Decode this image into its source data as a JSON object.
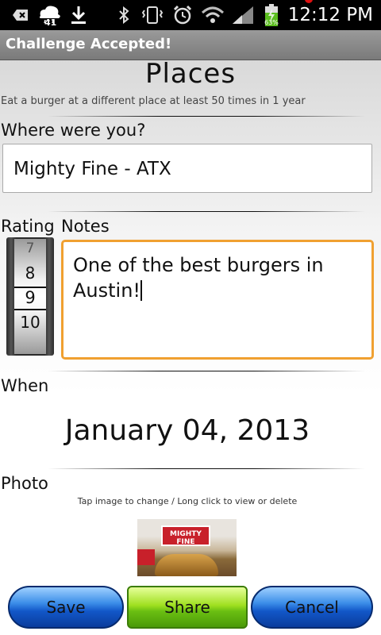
{
  "status_bar": {
    "time": "12:12 PM",
    "battery_percent": "63%",
    "weather_temp": "41",
    "icons": [
      "keyboard-back-icon",
      "weather-cloud-icon",
      "download-icon",
      "bluetooth-icon",
      "vibrate-icon",
      "alarm-icon",
      "wifi-icon",
      "signal-icon",
      "battery-icon"
    ]
  },
  "title_bar": {
    "title": "Challenge Accepted!"
  },
  "page": {
    "title": "Places",
    "subtitle": "Eat a burger at a different place at least 50 times in 1 year"
  },
  "where": {
    "label": "Where were you?",
    "value": "Mighty Fine - ATX"
  },
  "rating": {
    "label": "Rating",
    "options": [
      "7",
      "8",
      "9",
      "10"
    ],
    "selected": "9"
  },
  "notes": {
    "label": "Notes",
    "value": "One of the best burgers in Austin!"
  },
  "when": {
    "label": "When",
    "date": "January 04, 2013"
  },
  "photo": {
    "label": "Photo",
    "hint": "Tap image to change / Long click to view or delete",
    "sign_text": "MIGHTY FINE"
  },
  "buttons": {
    "save": "Save",
    "share": "Share",
    "cancel": "Cancel"
  },
  "colors": {
    "notes_focus_border": "#f0a030",
    "title_bar": "#8a8a8a",
    "save_cancel": "#1257c8",
    "share": "#6bbf12"
  }
}
